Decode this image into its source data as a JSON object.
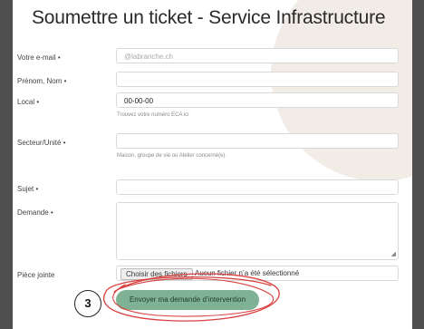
{
  "page": {
    "title": "Soumettre un ticket - Service Infrastructure"
  },
  "form": {
    "email": {
      "label": "Votre e-mail •",
      "placeholder": "@labranche.ch"
    },
    "name": {
      "label": "Prénom, Nom •",
      "value": ""
    },
    "local": {
      "label": "Local •",
      "value": "00-00-00",
      "hint": "Trouvez votre numéro ECA ici"
    },
    "sector": {
      "label": "Secteur/Unité •",
      "value": "",
      "hint": "Maison, groupe de vie ou Atelier concerné(e)."
    },
    "subject": {
      "label": "Sujet •",
      "value": ""
    },
    "request": {
      "label": "Demande •",
      "value": ""
    },
    "attachment": {
      "label": "Pièce jointe",
      "choose_label": "Choisir des fichiers",
      "no_file_text": "Aucun fichier n’a été sélectionné"
    },
    "submit_label": "Envoyer ma demande d’intervention"
  },
  "annotation": {
    "step_number": "3",
    "color": "#d94040"
  },
  "colors": {
    "submit_bg": "#7fb195",
    "background": "#4f4f4f",
    "decor": "#f1ece6"
  }
}
